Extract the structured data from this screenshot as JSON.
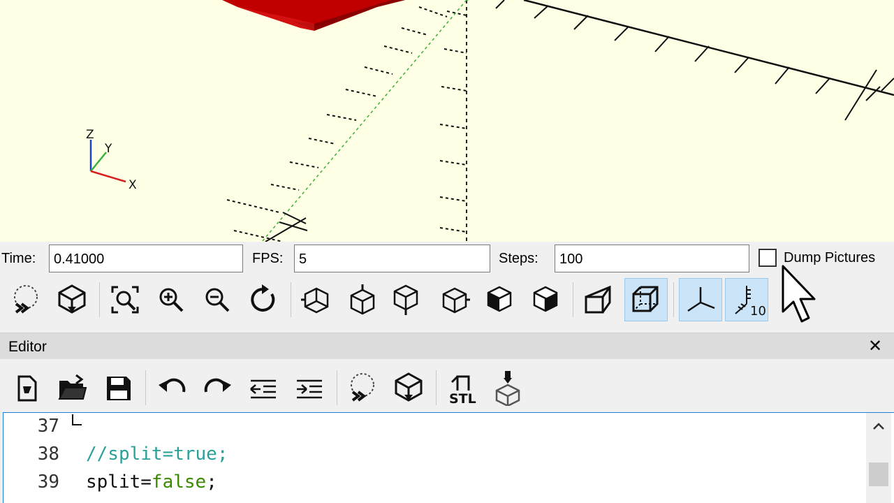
{
  "animation": {
    "time_label": "Time:",
    "time_value": "0.41000",
    "fps_label": "FPS:",
    "fps_value": "5",
    "steps_label": "Steps:",
    "steps_value": "100",
    "dump_label": "Dump Pictures",
    "dump_checked": false
  },
  "axis_labels": {
    "x": "X",
    "y": "Y",
    "z": "Z"
  },
  "view_toolbar": [
    {
      "icon": "preview-icon"
    },
    {
      "icon": "render-icon"
    },
    {
      "icon": "view-all-icon"
    },
    {
      "icon": "zoom-in-icon"
    },
    {
      "icon": "zoom-out-icon"
    },
    {
      "icon": "reset-view-icon"
    },
    {
      "icon": "view-right-icon"
    },
    {
      "icon": "view-top-icon"
    },
    {
      "icon": "view-bottom-icon"
    },
    {
      "icon": "view-left-icon"
    },
    {
      "icon": "view-front-icon"
    },
    {
      "icon": "view-back-icon"
    },
    {
      "icon": "perspective-icon"
    },
    {
      "icon": "orthogonal-icon",
      "active": true
    },
    {
      "icon": "show-axes-icon",
      "active": true
    },
    {
      "icon": "show-scale-markers-icon",
      "active": true,
      "text": "10"
    }
  ],
  "editor": {
    "title": "Editor",
    "close": "✕",
    "toolbar": [
      {
        "icon": "new-file-icon"
      },
      {
        "icon": "open-file-icon"
      },
      {
        "icon": "save-file-icon"
      },
      {
        "icon": "undo-icon"
      },
      {
        "icon": "redo-icon"
      },
      {
        "icon": "unindent-icon"
      },
      {
        "icon": "indent-icon"
      },
      {
        "icon": "preview-icon"
      },
      {
        "icon": "render-icon"
      },
      {
        "icon": "export-stl-icon",
        "text": "STL"
      },
      {
        "icon": "send-to-printer-icon"
      }
    ],
    "lines": [
      {
        "num": "37",
        "text": ""
      },
      {
        "num": "38",
        "comment": "//split=true;"
      },
      {
        "num": "39",
        "ident": "split=",
        "bool": "false",
        "rest": ";"
      }
    ]
  },
  "colors": {
    "viewport_bg": "#ffffe5",
    "model_red": "#cc0000",
    "active_button": "#cce4f7",
    "editor_border": "#1e7fd6"
  }
}
